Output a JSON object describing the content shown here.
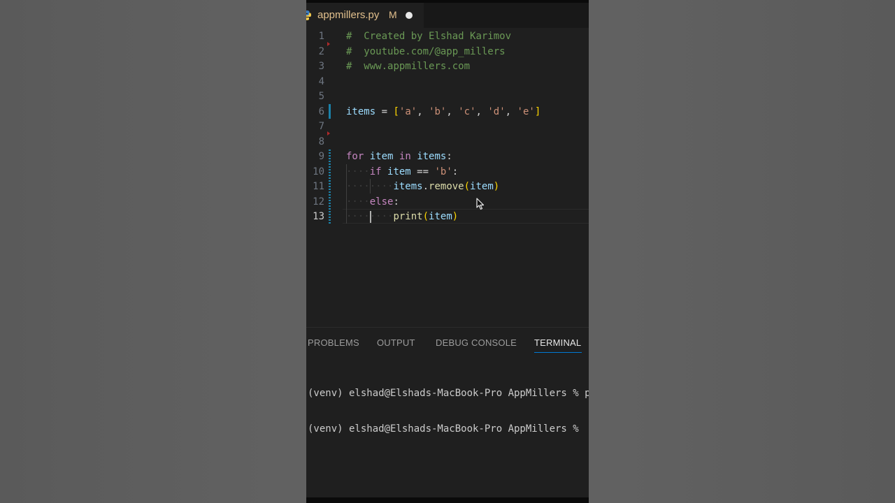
{
  "tab": {
    "filename": "appmillers.py",
    "status": "M"
  },
  "code_lines": [
    {
      "num": "1"
    },
    {
      "num": "2"
    },
    {
      "num": "3"
    },
    {
      "num": "4"
    },
    {
      "num": "5"
    },
    {
      "num": "6"
    },
    {
      "num": "7"
    },
    {
      "num": "8"
    },
    {
      "num": "9"
    },
    {
      "num": "10"
    },
    {
      "num": "11"
    },
    {
      "num": "12"
    },
    {
      "num": "13"
    }
  ],
  "code": {
    "l1_hash": "#",
    "l1_text": "Created by Elshad Karimov",
    "l2_hash": "#",
    "l2_text": "youtube.com/@app_millers",
    "l3_hash": "#",
    "l3_text": "www.appmillers.com",
    "l6_var": "items",
    "l6_eq": "=",
    "l6_lbr": "[",
    "l6_items": [
      "'a'",
      "'b'",
      "'c'",
      "'d'",
      "'e'"
    ],
    "l6_rbr": "]",
    "l9_for": "for",
    "l9_item": "item",
    "l9_in": "in",
    "l9_items": "items",
    "l9_colon": ":",
    "l10_if": "if",
    "l10_item": "item",
    "l10_eq": "==",
    "l10_str": "'b'",
    "l10_colon": ":",
    "l11_obj": "items",
    "l11_dot": ".",
    "l11_fn": "remove",
    "l11_lp": "(",
    "l11_arg": "item",
    "l11_rp": ")",
    "l12_else": "else",
    "l12_colon": ":",
    "l13_fn": "print",
    "l13_lp": "(",
    "l13_arg": "item",
    "l13_rp": ")"
  },
  "panel": {
    "tabs": [
      "PROBLEMS",
      "OUTPUT",
      "DEBUG CONSOLE",
      "TERMINAL"
    ],
    "active_tab": "TERMINAL"
  },
  "terminal": {
    "lines": [
      "(venv) elshad@Elshads-MacBook-Pro AppMillers % py",
      "(venv) elshad@Elshads-MacBook-Pro AppMillers % "
    ]
  },
  "colors": {
    "accent": "#0078d4",
    "modified": "#e2c08d",
    "comment": "#6a9955",
    "keyword": "#c586c0",
    "variable": "#9cdcfe",
    "string": "#ce9178",
    "function": "#dcdcaa"
  }
}
